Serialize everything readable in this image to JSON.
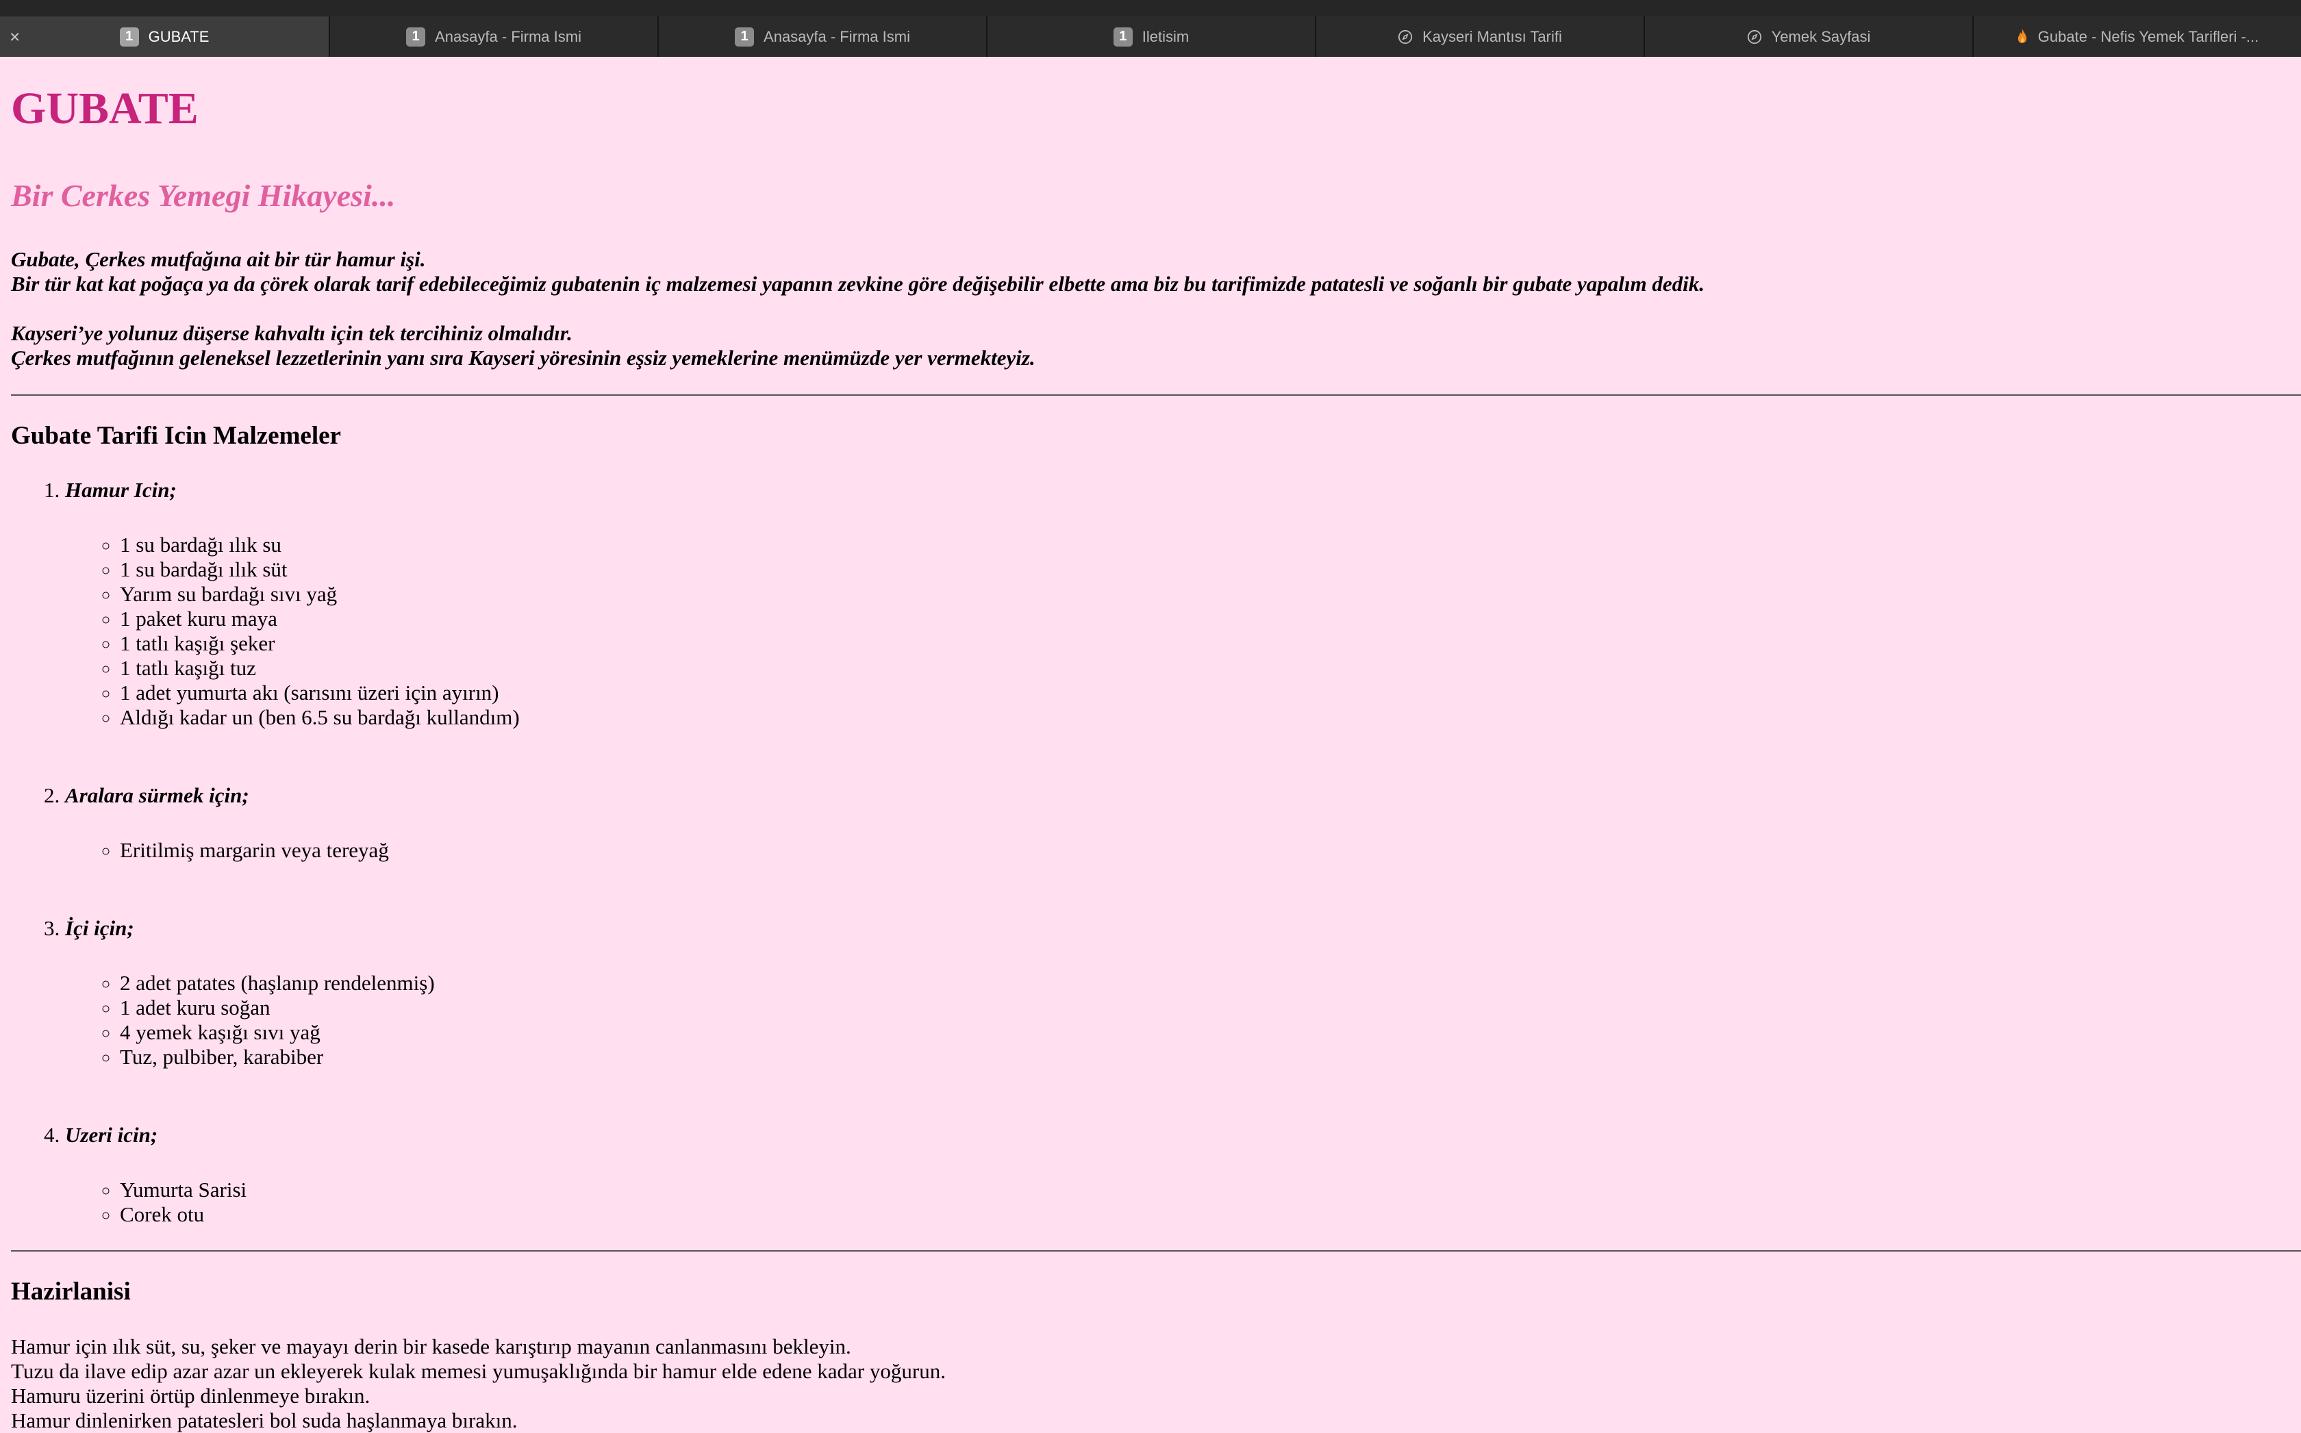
{
  "tabs": [
    {
      "badge": "1",
      "label": "GUBATE",
      "active": true,
      "icon": "number-badge"
    },
    {
      "badge": "1",
      "label": "Anasayfa - Firma Ismi",
      "icon": "number-badge"
    },
    {
      "badge": "1",
      "label": "Anasayfa - Firma Ismi",
      "icon": "number-badge"
    },
    {
      "badge": "1",
      "label": "Iletisim",
      "icon": "number-badge"
    },
    {
      "label": "Kayseri Mantısı Tarifi",
      "icon": "compass-icon"
    },
    {
      "label": "Yemek Sayfasi",
      "icon": "compass-icon"
    },
    {
      "label": "Gubate - Nefis Yemek Tarifleri -...",
      "icon": "flame-icon"
    }
  ],
  "tab_close": "×",
  "colors": {
    "page_bg": "#ffdff0",
    "title": "#c6237c",
    "subtitle": "#e0609f"
  },
  "page": {
    "title": "GUBATE",
    "subtitle": "Bir Cerkes Yemegi Hikayesi...",
    "intro": [
      [
        "Gubate, Çerkes mutfağına ait bir tür hamur işi.",
        "Bir tür kat kat poğaça ya da çörek olarak tarif edebileceğimiz gubatenin iç malzemesi yapanın zevkine göre değişebilir elbette ama biz bu tarifimizde patatesli ve soğanlı bir gubate yapalım dedik."
      ],
      [
        "Kayseri’ye yolunuz düşerse kahvaltı için tek tercihiniz olmalıdır.",
        "Çerkes mutfağının geleneksel lezzetlerinin yanı sıra Kayseri yöresinin eşsiz yemeklerine menümüzde yer vermekteyiz."
      ]
    ],
    "ingredients_heading": "Gubate Tarifi Icin Malzemeler",
    "groups": [
      {
        "title": "Hamur Icin;",
        "items": [
          "1 su bardağı ılık su",
          "1 su bardağı ılık süt",
          "Yarım su bardağı sıvı yağ",
          "1 paket kuru maya",
          "1 tatlı kaşığı şeker",
          "1 tatlı kaşığı tuz",
          "1 adet yumurta akı (sarısını üzeri için ayırın)",
          "Aldığı kadar un (ben 6.5 su bardağı kullandım)"
        ]
      },
      {
        "title": "Aralara sürmek için;",
        "items": [
          "Eritilmiş margarin veya tereyağ"
        ]
      },
      {
        "title": "İçi için;",
        "items": [
          "2 adet patates (haşlanıp rendelenmiş)",
          "1 adet kuru soğan",
          "4 yemek kaşığı sıvı yağ",
          "Tuz, pulbiber, karabiber"
        ]
      },
      {
        "title": "Uzeri icin;",
        "items": [
          "Yumurta Sarisi",
          "Corek otu"
        ]
      }
    ],
    "prep_heading": "Hazirlanisi",
    "prep_lines": [
      "Hamur için ılık süt, su, şeker ve mayayı derin bir kasede karıştırıp mayanın canlanmasını bekleyin.",
      "Tuzu da ilave edip azar azar un ekleyerek kulak memesi yumuşaklığında bir hamur elde edene kadar yoğurun.",
      "Hamuru üzerini örtüp dinlenmeye bırakın.",
      "Hamur dinlenirken patatesleri bol suda haşlanmaya bırakın."
    ]
  }
}
